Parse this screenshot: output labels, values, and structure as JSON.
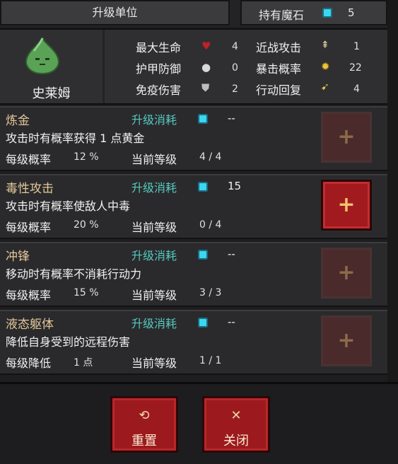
{
  "header": {
    "title": "升级单位",
    "stone_label": "持有魔石",
    "stone_count": "5"
  },
  "unit": {
    "name": "史莱姆",
    "stats": [
      {
        "label": "最大生命",
        "icon": "heart-icon",
        "value": "4"
      },
      {
        "label": "近战攻击",
        "icon": "sword-icon",
        "value": "1"
      },
      {
        "label": "护甲防御",
        "icon": "shield-round-icon",
        "value": "0"
      },
      {
        "label": "暴击概率",
        "icon": "spark-icon",
        "value": "22"
      },
      {
        "label": "免疫伤害",
        "icon": "shield-icon",
        "value": "2"
      },
      {
        "label": "行动回复",
        "icon": "boot-icon",
        "value": "4"
      }
    ]
  },
  "skills": [
    {
      "name": "炼金",
      "cost_label": "升级消耗",
      "cost": "--",
      "desc": "攻击时有概率获得 1 点黄金",
      "rate_label": "每级概率",
      "rate": "12 %",
      "level_label": "当前等级",
      "level": "4 / 4"
    },
    {
      "name": "毒性攻击",
      "cost_label": "升级消耗",
      "cost": "15",
      "desc": "攻击时有概率使敌人中毒",
      "rate_label": "每级概率",
      "rate": "20 %",
      "level_label": "当前等级",
      "level": "0 / 4"
    },
    {
      "name": "冲锋",
      "cost_label": "升级消耗",
      "cost": "--",
      "desc": "移动时有概率不消耗行动力",
      "rate_label": "每级概率",
      "rate": "15 %",
      "level_label": "当前等级",
      "level": "3 / 3"
    },
    {
      "name": "液态躯体",
      "cost_label": "升级消耗",
      "cost": "--",
      "desc": "降低自身受到的远程伤害",
      "rate_label": "每级降低",
      "rate": "1 点",
      "level_label": "当前等级",
      "level": "1 / 1"
    }
  ],
  "buttons": {
    "reset": "重置",
    "close": "关闭",
    "plus": "+"
  },
  "colors": {
    "accent_red": "#a01a1e",
    "gem_cyan": "#3cd6f0",
    "name_gold": "#e2c79a",
    "cost_teal": "#56c9c0"
  }
}
